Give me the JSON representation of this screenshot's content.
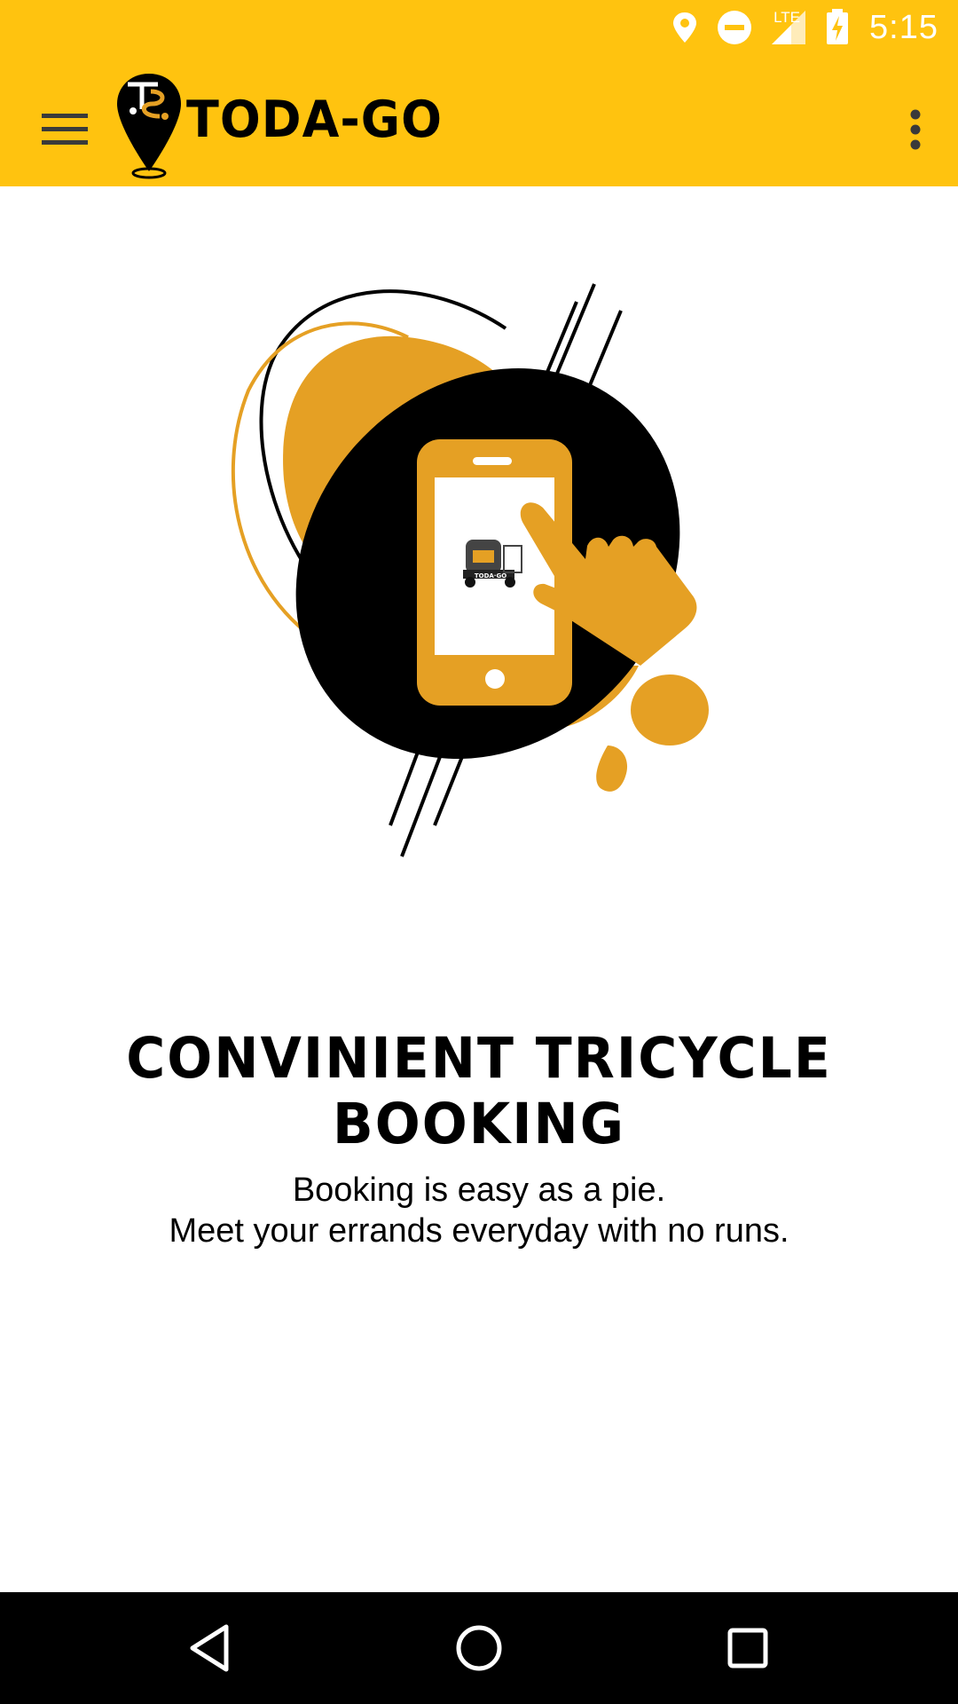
{
  "status_bar": {
    "network_label": "LTE",
    "time": "5:15"
  },
  "app_bar": {
    "brand": "TODA-GO",
    "logo_letters": "TS",
    "menu_icon": "hamburger-menu-icon",
    "overflow_icon": "more-vertical-icon"
  },
  "hero": {
    "tricycle_plate": "TODA-GO"
  },
  "content": {
    "headline": "CONVINIENT TRICYCLE BOOKING",
    "subtext_line1": "Booking is easy as a pie.",
    "subtext_line2": "Meet your errands everyday with no runs."
  },
  "nav_bar": {
    "back_icon": "back-triangle-icon",
    "home_icon": "home-circle-icon",
    "recents_icon": "recents-square-icon"
  },
  "colors": {
    "app_bar": "#FFC30F",
    "accent_orange": "#E5A024",
    "text": "#000000",
    "nav_bar": "#000000"
  }
}
